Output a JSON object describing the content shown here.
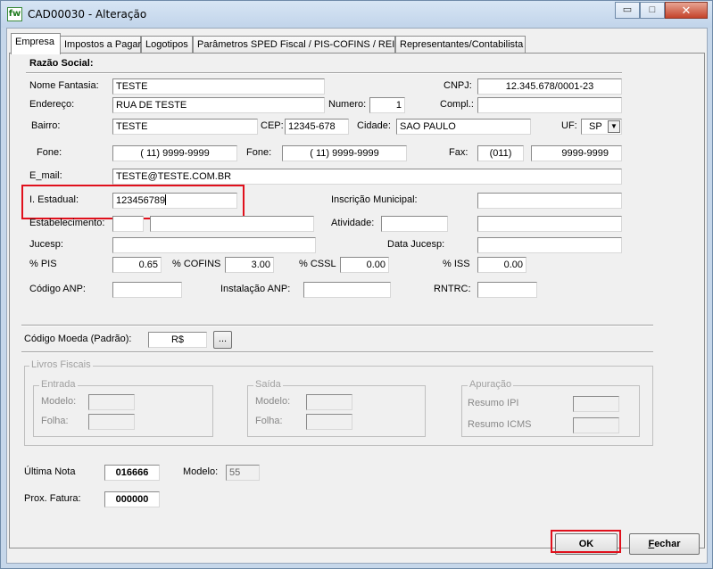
{
  "window": {
    "title": "CAD00030 - Alteração",
    "app_icon_text": "fw",
    "controls": {
      "minimize": "▭",
      "maximize": "□",
      "close": "✕"
    }
  },
  "tabs": [
    {
      "label": "Empresa",
      "active": true
    },
    {
      "label": "Impostos a Pagar",
      "active": false
    },
    {
      "label": "Logotipos",
      "active": false
    },
    {
      "label": "Parâmetros SPED Fiscal / PIS-COFINS / REINF",
      "active": false
    },
    {
      "label": "Representantes/Contabilista",
      "active": false
    }
  ],
  "form": {
    "razao_social_label": "Razão Social:",
    "nome_fantasia": {
      "label": "Nome Fantasia:",
      "value": "TESTE"
    },
    "cnpj": {
      "label": "CNPJ:",
      "value": "12.345.678/0001-23"
    },
    "endereco": {
      "label": "Endereço:",
      "value": "RUA DE TESTE"
    },
    "numero": {
      "label": "Numero:",
      "value": "1"
    },
    "compl": {
      "label": "Compl.:",
      "value": ""
    },
    "bairro": {
      "label": "Bairro:",
      "value": "TESTE"
    },
    "cep": {
      "label": "CEP:",
      "value": "12345-678"
    },
    "cidade": {
      "label": "Cidade:",
      "value": "SAO PAULO"
    },
    "uf": {
      "label": "UF:",
      "value": "SP"
    },
    "fone1": {
      "label": "Fone:",
      "value": "( 11) 9999-9999"
    },
    "fone2": {
      "label": "Fone:",
      "value": "( 11) 9999-9999"
    },
    "fax": {
      "label": "Fax:",
      "ddd": "(011)",
      "value": "9999-9999"
    },
    "email": {
      "label": "E_mail:",
      "value": "TESTE@TESTE.COM.BR"
    },
    "inscricao_estadual": {
      "label": "I. Estadual:",
      "value": "123456789"
    },
    "inscricao_municipal": {
      "label": "Inscrição Municipal:",
      "value": ""
    },
    "estabelecimento": {
      "label": "Estabelecimento:",
      "code": "",
      "value": ""
    },
    "atividade": {
      "label": "Atividade:",
      "code": "",
      "value": ""
    },
    "jucesp": {
      "label": "Jucesp:",
      "value": ""
    },
    "data_jucesp": {
      "label": "Data Jucesp:",
      "value": ""
    },
    "pis": {
      "label": "% PIS",
      "value": "0.65"
    },
    "cofins": {
      "label": "% COFINS",
      "value": "3.00"
    },
    "cssl": {
      "label": "% CSSL",
      "value": "0.00"
    },
    "iss": {
      "label": "% ISS",
      "value": "0.00"
    },
    "codigo_anp": {
      "label": "Código ANP:",
      "value": ""
    },
    "instalacao_anp": {
      "label": "Instalação ANP:",
      "value": ""
    },
    "rntrc": {
      "label": "RNTRC:",
      "value": ""
    },
    "codigo_moeda": {
      "label": "Código Moeda (Padrão):",
      "value": "R$",
      "lookup": "..."
    }
  },
  "livros_fiscais": {
    "title": "Livros Fiscais",
    "entrada": {
      "title": "Entrada",
      "modelo_label": "Modelo:",
      "modelo": "",
      "folha_label": "Folha:",
      "folha": ""
    },
    "saida": {
      "title": "Saída",
      "modelo_label": "Modelo:",
      "modelo": "",
      "folha_label": "Folha:",
      "folha": ""
    },
    "apuracao": {
      "title": "Apuração",
      "ipi_label": "Resumo IPI",
      "ipi": "",
      "icms_label": "Resumo ICMS",
      "icms": ""
    }
  },
  "footer": {
    "ultima_nota": {
      "label": "Última Nota",
      "value": "016666"
    },
    "modelo": {
      "label": "Modelo:",
      "value": "55"
    },
    "prox_fatura": {
      "label": "Prox.  Fatura:",
      "value": "000000"
    }
  },
  "buttons": {
    "ok": "OK",
    "fechar_u": "F",
    "fechar_rest": "echar"
  },
  "colors": {
    "highlight": "#e0101c",
    "titlebar": "#c6d7ea"
  }
}
